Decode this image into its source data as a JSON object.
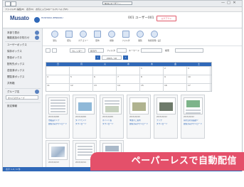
{
  "browser": {
    "tab_title": "NOG ユーザー…",
    "menu": [
      "ファイル(F)",
      "編集(E)",
      "表示(V)",
      "お気に入り(A)",
      "ツール(T)",
      "ヘルプ(H)"
    ],
    "window_controls": [
      "—",
      "□",
      "✕"
    ]
  },
  "header": {
    "logo": "Musato",
    "sub_logo": "HOSHOKU ZENKOKU",
    "title": "001 ユーザー001",
    "logout_label": "ログアウト"
  },
  "sidebar": {
    "items": [
      "本部で表示",
      "機能追加のお知らせ",
      "ユーザーボックス",
      "保存ボックス",
      "受信ボックス",
      "配布先ボックス",
      "送信済ボックス",
      "閲覧済ボックス",
      "共有箱"
    ],
    "group_label": "グループ名",
    "select_value": "すべてのグループ",
    "bottom_label": "設定情報"
  },
  "toolbar": {
    "buttons": [
      "受信",
      "配信",
      "カテゴリー",
      "配布",
      "削除",
      "フォルダ",
      "閲覧",
      "情報管理 / 設定"
    ]
  },
  "controls": {
    "view_select": "カレンダー",
    "period_select": "年月日",
    "filter_label": "フィルタ",
    "keyword_label": "キーワード",
    "range_label": "検索",
    "month": "2015 / 10"
  },
  "calendar": {
    "weekdays": [
      "日",
      "月",
      "火",
      "水",
      "木",
      "金",
      "土"
    ],
    "weeks": [
      [
        "",
        "",
        "",
        "",
        "1",
        "2",
        "3"
      ],
      [
        "4",
        "5",
        "6",
        "7",
        "8",
        "9",
        "10"
      ],
      [
        "11",
        "12",
        "13",
        "14",
        "15",
        "16",
        "17"
      ]
    ]
  },
  "documents": [
    {
      "line1": "2015/10/08",
      "line2": "市販品パンフ",
      "line3": "閲覧済みダウンロード",
      "kind": "doc"
    },
    {
      "line1": "2015/10/09",
      "line2": "ダイヤモンド",
      "line3": "ダウンロード",
      "kind": "photo"
    },
    {
      "line1": "2015/10/09",
      "line2": "ポイント版",
      "line3": "ダウンロード",
      "kind": "doc"
    },
    {
      "line1": "2015/10/10",
      "line2": "季節のご案内",
      "line3": "閲覧済みダウンロード",
      "kind": "photo"
    },
    {
      "line1": "2015/10/12",
      "line2": "ブック",
      "line3": "ダウンロード",
      "kind": "photo"
    },
    {
      "line1": "2015/10/12",
      "line2": "南の島の商品紹介",
      "line3": "閲覧済みダウンロード",
      "kind": "doc"
    },
    {
      "line1": "2015/10/13",
      "line2": "",
      "line3": "",
      "kind": "doc"
    },
    {
      "line1": "2015/10/14",
      "line2": "",
      "line3": "",
      "kind": "doc"
    },
    {
      "line1": "2015/10/15",
      "line2": "",
      "line3": "",
      "kind": "doc"
    }
  ],
  "footer_text": "表示 1-9 / 9 件",
  "banner_text": "ペーパーレスで自動配信",
  "colors": {
    "accent": "#2f68b8",
    "banner": "#e4506a"
  }
}
